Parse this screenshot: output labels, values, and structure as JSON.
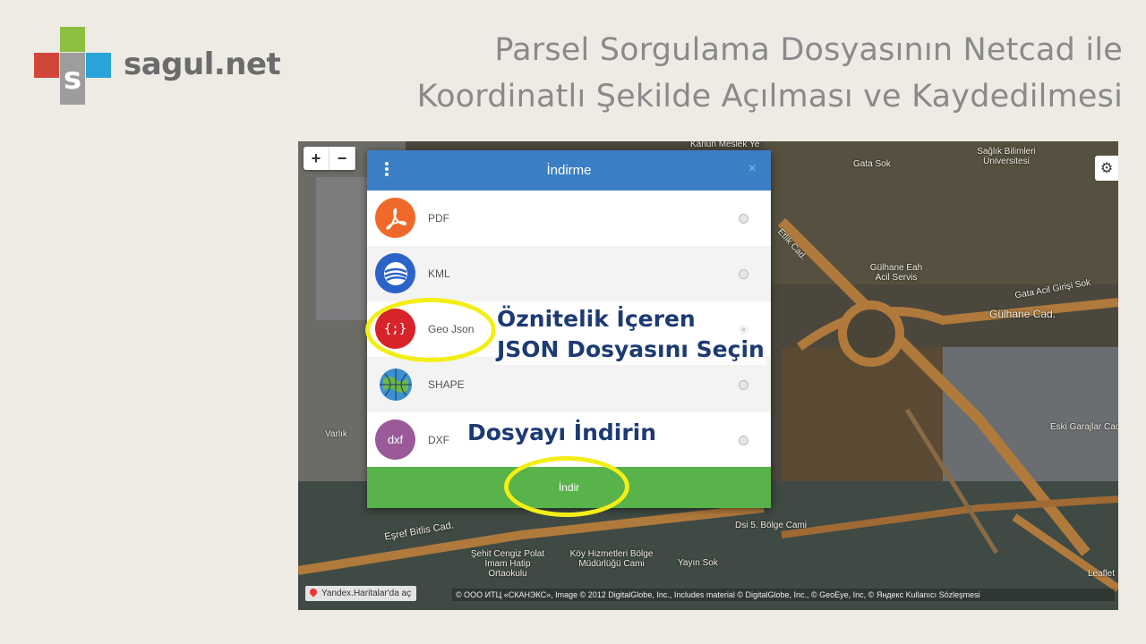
{
  "brand": {
    "logo_letter": "s",
    "name": "sagul.net",
    "colors": {
      "green": "#8cbf3f",
      "red": "#d2463a",
      "blue": "#2aa3d8",
      "gray": "#9d9d9d"
    }
  },
  "title": {
    "line1": "Parsel Sorgulama Dosyasının Netcad ile",
    "line2": "Koordinatlı Şekilde Açılması ve Kaydedilmesi"
  },
  "map": {
    "zoom_in": "+",
    "zoom_out": "−",
    "settings_icon": "gear-icon",
    "labels": [
      "Kanun Meslek Ye",
      "Sağlık Bilimleri Üniversitesi",
      "Gata Sok",
      "Gülhane Eah Acil Servis",
      "Etlik Cad.",
      "Gülhane Cad.",
      "Gata Acil Girişi Sok",
      "Eski Garajlar Cad.",
      "Eşref Bitlis Cad.",
      "Köy Hizmetleri Bölge Müdürlüğü Cami",
      "Dsi 5. Bölge Cami",
      "Şehit Cengiz Polat İmam Hatip Ortaokulu",
      "Yayın Sok",
      "Varlık",
      "Leaflet"
    ],
    "yandex_link": "Yandex.Haritalar'da aç",
    "copyright": "© ООО ИТЦ «СКАНЭКС», Image © 2012 DigitalGlobe, Inc., Includes material © DigitalGlobe, Inc., © GeoEye, Inc, © Яндекс Kullanıcı Sözleşmesi"
  },
  "dialog": {
    "title": "İndirme",
    "close": "×",
    "formats": [
      {
        "label": "PDF",
        "icon": "pdf-icon",
        "selected": false
      },
      {
        "label": "KML",
        "icon": "globe-icon",
        "selected": false
      },
      {
        "label": "Geo Json",
        "icon": "json-braces-icon",
        "icon_text": "{;}",
        "selected": true
      },
      {
        "label": "SHAPE",
        "icon": "shape-globe-icon",
        "selected": false
      },
      {
        "label": "DXF",
        "icon": "dxf-icon",
        "icon_text": "dxf",
        "selected": false
      }
    ],
    "download_button": "İndir",
    "header_color": "#3a7fc4",
    "download_color": "#57b34a"
  },
  "annotations": {
    "select_json_line1": "Öznitelik İçeren",
    "select_json_line2": "JSON Dosyasını Seçin",
    "download_file": "Dosyayı İndirin",
    "highlight_color": "#f4ee16"
  }
}
